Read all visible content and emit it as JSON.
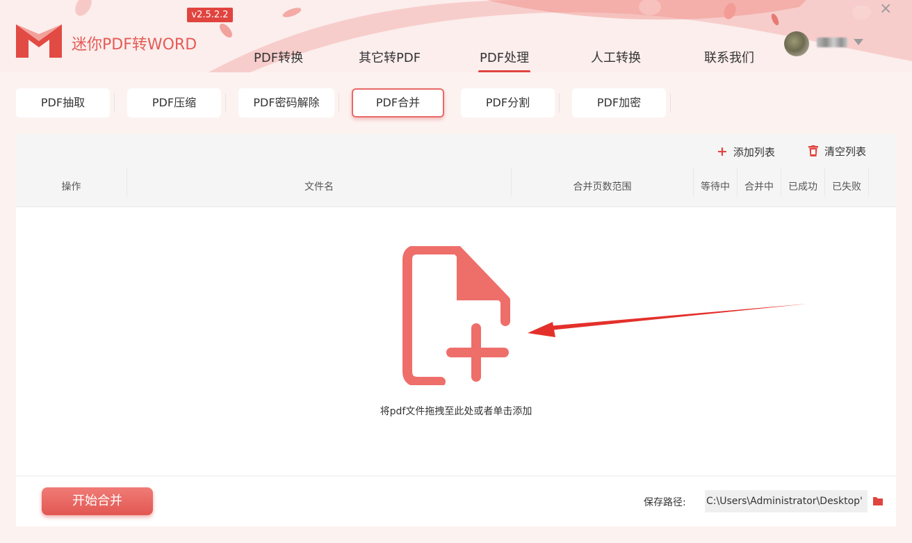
{
  "app": {
    "title": "迷你PDF转WORD",
    "version": "v2.5.2.2"
  },
  "nav": {
    "items": [
      {
        "label": "PDF转换"
      },
      {
        "label": "其它转PDF"
      },
      {
        "label": "PDF处理",
        "active": true
      },
      {
        "label": "人工转换"
      },
      {
        "label": "联系我们"
      }
    ]
  },
  "window": {
    "close_glyph": "×"
  },
  "subtabs": [
    {
      "label": "PDF抽取"
    },
    {
      "label": "PDF压缩"
    },
    {
      "label": "PDF密码解除"
    },
    {
      "label": "PDF合并",
      "active": true
    },
    {
      "label": "PDF分割"
    },
    {
      "label": "PDF加密"
    }
  ],
  "toolbar": {
    "add_icon": "plus-icon",
    "add_label": "添加列表",
    "clear_icon": "trash-icon",
    "clear_label": "清空列表"
  },
  "table": {
    "headers": [
      "操作",
      "文件名",
      "合并页数范围",
      "等待中",
      "合并中",
      "已成功",
      "已失败"
    ]
  },
  "dropzone": {
    "icon": "file-add-icon",
    "hint": "将pdf文件拖拽至此处或者单击添加"
  },
  "footer": {
    "start_label": "开始合并",
    "save_path_label": "保存路径:",
    "save_path_value": "C:\\Users\\Administrator\\Desktop'",
    "folder_icon": "folder-icon"
  },
  "colors": {
    "accent": "#e0443f",
    "accent_light": "#f07b76",
    "page_bg": "#fcf3f1"
  }
}
